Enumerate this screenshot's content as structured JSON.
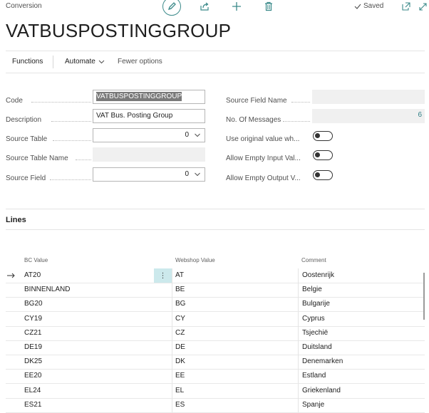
{
  "header": {
    "caption": "Conversion",
    "title": "VATBUSPOSTINGGROUP",
    "saved_label": "Saved",
    "icons": [
      "pencil-icon",
      "share-icon",
      "plus-icon",
      "trash-icon",
      "checkmark-icon",
      "open-new-window-icon",
      "expand-icon"
    ]
  },
  "actionbar": {
    "functions": "Functions",
    "automate": "Automate",
    "fewer_options": "Fewer options"
  },
  "fields_left": {
    "code_label": "Code",
    "code_value": "VATBUSPOSTINGGROUP",
    "description_label": "Description",
    "description_value": "VAT Bus. Posting Group",
    "source_table_label": "Source Table",
    "source_table_value": "0",
    "source_table_name_label": "Source Table Name",
    "source_table_name_value": "",
    "source_field_label": "Source Field",
    "source_field_value": "0"
  },
  "fields_right": {
    "source_field_name_label": "Source Field Name",
    "source_field_name_value": "",
    "no_of_messages_label": "No. Of Messages",
    "no_of_messages_value": "6",
    "use_original_label": "Use original value wh...",
    "use_original_on": false,
    "allow_empty_input_label": "Allow Empty Input Val...",
    "allow_empty_input_on": false,
    "allow_empty_output_label": "Allow Empty Output V...",
    "allow_empty_output_on": false
  },
  "lines": {
    "title": "Lines",
    "columns": {
      "bc_value": "BC Value",
      "webshop_value": "Webshop Value",
      "comment": "Comment"
    },
    "rows": [
      {
        "bc": "AT20",
        "webshop": "AT",
        "comment": "Oostenrijk"
      },
      {
        "bc": "BINNENLAND",
        "webshop": "BE",
        "comment": "Belgie"
      },
      {
        "bc": "BG20",
        "webshop": "BG",
        "comment": "Bulgarije"
      },
      {
        "bc": "CY19",
        "webshop": "CY",
        "comment": "Cyprus"
      },
      {
        "bc": "CZ21",
        "webshop": "CZ",
        "comment": "Tsjechië"
      },
      {
        "bc": "DE19",
        "webshop": "DE",
        "comment": "Duitsland"
      },
      {
        "bc": "DK25",
        "webshop": "DK",
        "comment": "Denemarken"
      },
      {
        "bc": "EE20",
        "webshop": "EE",
        "comment": "Estland"
      },
      {
        "bc": "EL24",
        "webshop": "EL",
        "comment": "Griekenland"
      },
      {
        "bc": "ES21",
        "webshop": "ES",
        "comment": "Spanje"
      }
    ]
  }
}
